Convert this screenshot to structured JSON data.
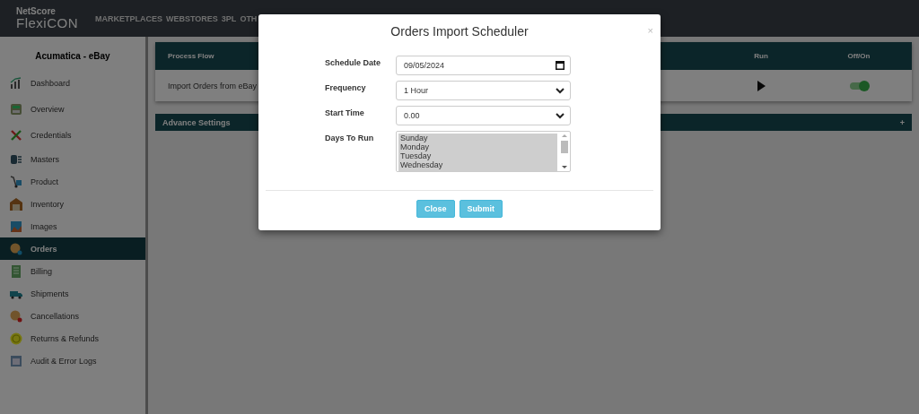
{
  "logo": {
    "line1": "NetScore",
    "line2": "FlexiCON"
  },
  "nav": [
    "MARKETPLACES",
    "WEBSTORES",
    "3PL",
    "OTH"
  ],
  "sidebar": {
    "title": "Acumatica - eBay",
    "items": [
      {
        "label": "Dashboard",
        "selected": false
      },
      {
        "label": "Overview",
        "selected": false
      },
      {
        "label": "Credentials",
        "selected": false
      },
      {
        "label": "Masters",
        "selected": false
      },
      {
        "label": "Product",
        "selected": false
      },
      {
        "label": "Inventory",
        "selected": false
      },
      {
        "label": "Images",
        "selected": false
      },
      {
        "label": "Orders",
        "selected": true
      },
      {
        "label": "Billing",
        "selected": false
      },
      {
        "label": "Shipments",
        "selected": false
      },
      {
        "label": "Cancellations",
        "selected": false
      },
      {
        "label": "Returns & Refunds",
        "selected": false
      },
      {
        "label": "Audit & Error Logs",
        "selected": false
      }
    ]
  },
  "process": {
    "columns": [
      "Process Flow",
      "Run",
      "Off/On"
    ],
    "rows": [
      {
        "name": "Import Orders from eBay",
        "on": true
      }
    ]
  },
  "advance_settings": {
    "title": "Advance Settings",
    "expander": "+"
  },
  "modal": {
    "title": "Orders Import Scheduler",
    "close_icon": "×",
    "fields": [
      {
        "label": "Schedule Date",
        "kind": "date",
        "value": "09/05/2024"
      },
      {
        "label": "Frequency",
        "kind": "select",
        "value": "1 Hour"
      },
      {
        "label": "Start Time",
        "kind": "select",
        "value": "0.00"
      },
      {
        "label": "Days To Run",
        "kind": "listbox",
        "options": [
          {
            "label": "Sunday",
            "selected": true
          },
          {
            "label": "Monday",
            "selected": true
          },
          {
            "label": "Tuesday",
            "selected": true
          },
          {
            "label": "Wednesday",
            "selected": true
          }
        ]
      }
    ],
    "buttons": [
      "Close",
      "Submit"
    ]
  }
}
